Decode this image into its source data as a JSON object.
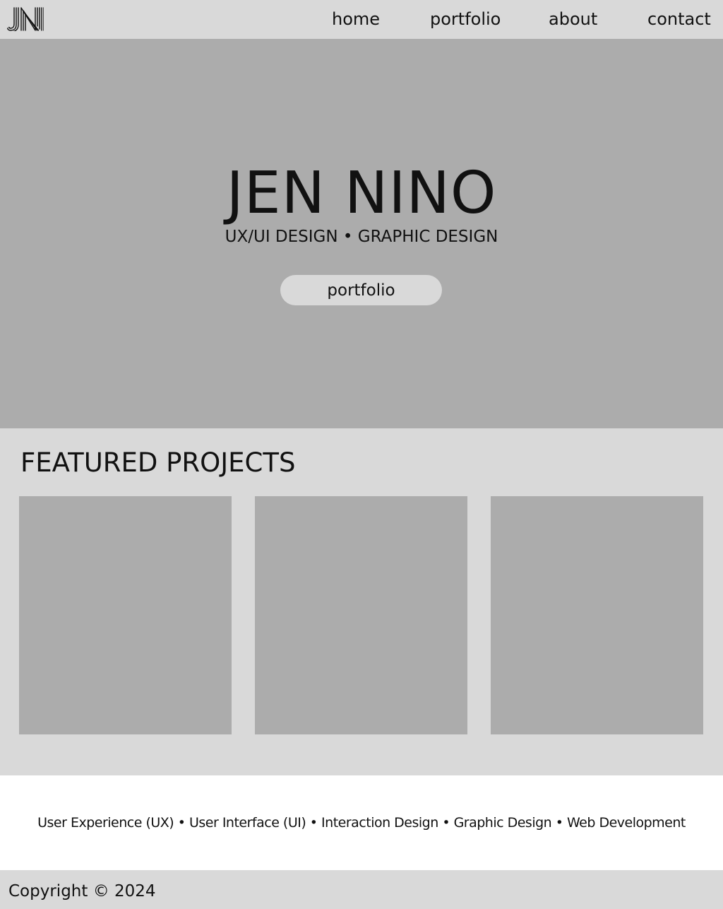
{
  "header": {
    "logo_text": "JN",
    "logo_icon": "jn-monogram-logo",
    "nav": {
      "home": "home",
      "portfolio": "portfolio",
      "about": "about",
      "contact": "contact"
    }
  },
  "hero": {
    "title": "JEN NINO",
    "subtitle": "UX/UI DESIGN • GRAPHIC DESIGN",
    "button_label": "portfolio"
  },
  "featured": {
    "title": "FEATURED PROJECTS",
    "projects": [
      "",
      "",
      ""
    ]
  },
  "skills": {
    "text": "User Experience (UX) • User Interface (UI) • Interaction Design • Graphic Design • Web Development"
  },
  "footer": {
    "copyright": "Copyright © 2024"
  },
  "colors": {
    "bar_background": "#d9d9d9",
    "block_gray": "#acacac",
    "white": "#ffffff",
    "text": "#111111"
  }
}
